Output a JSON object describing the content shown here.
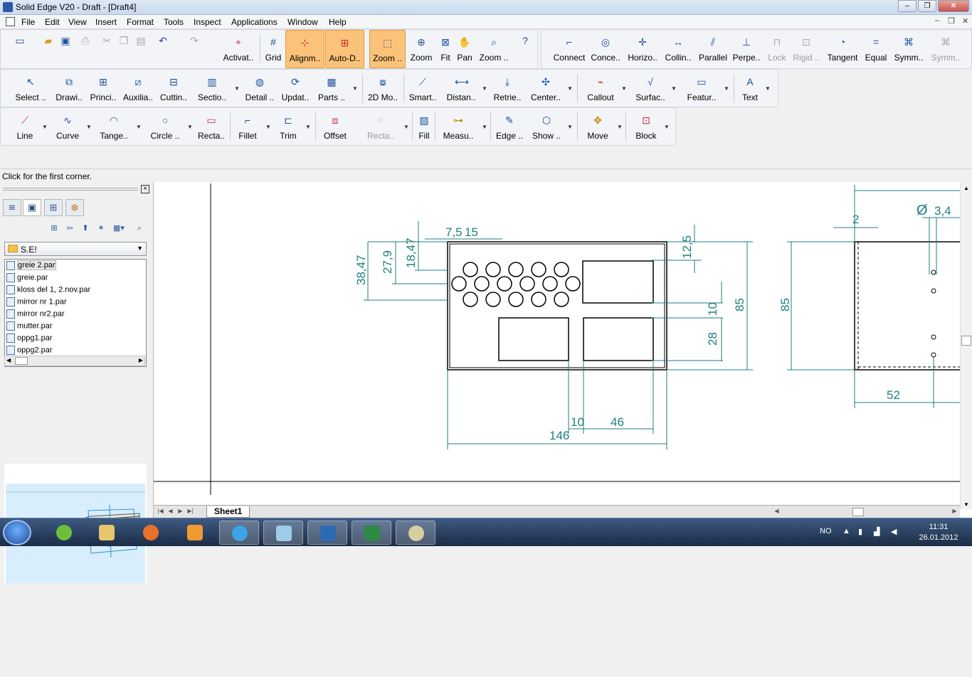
{
  "window": {
    "title": "Solid Edge V20 - Draft - [Draft4]",
    "min": "–",
    "max": "❐",
    "close": "✕"
  },
  "menubar": {
    "items": [
      "File",
      "Edit",
      "View",
      "Insert",
      "Format",
      "Tools",
      "Inspect",
      "Applications",
      "Window",
      "Help"
    ],
    "mdi": [
      "–",
      "❐",
      "✕"
    ]
  },
  "toolbar1": {
    "groupA": [
      {
        "label": "",
        "icon": "new-icon"
      },
      {
        "label": "",
        "icon": "open-icon"
      },
      {
        "label": "",
        "icon": "save-icon"
      },
      {
        "label": "",
        "icon": "print-icon"
      },
      {
        "label": "",
        "icon": "cut-icon"
      },
      {
        "label": "",
        "icon": "copy-icon"
      },
      {
        "label": "",
        "icon": "paste-icon"
      },
      {
        "label": "",
        "icon": "undo-icon"
      },
      {
        "label": "",
        "icon": "redo-icon"
      },
      {
        "label": "Activat..",
        "icon": "activate-icon"
      },
      {
        "label": "Grid",
        "icon": "grid-icon"
      },
      {
        "label": "Alignm..",
        "icon": "alignment-icon",
        "active": true
      },
      {
        "label": "Auto-D..",
        "icon": "auto-dimension-icon",
        "active": true
      },
      {
        "label": "Zoom ..",
        "icon": "zoom-area-icon",
        "active": true
      },
      {
        "label": "Zoom",
        "icon": "zoom-icon"
      },
      {
        "label": "Fit",
        "icon": "fit-icon"
      },
      {
        "label": "Pan",
        "icon": "pan-icon"
      },
      {
        "label": "Zoom ..",
        "icon": "zoom-previous-icon"
      },
      {
        "label": "",
        "icon": "help-icon"
      }
    ],
    "groupB": [
      {
        "label": "Connect",
        "icon": "connect-icon"
      },
      {
        "label": "Conce..",
        "icon": "concentric-icon"
      },
      {
        "label": "Horizo..",
        "icon": "horizontal-icon"
      },
      {
        "label": "Collin..",
        "icon": "collinear-icon"
      },
      {
        "label": "Parallel",
        "icon": "parallel-icon"
      },
      {
        "label": "Perpe..",
        "icon": "perpendicular-icon"
      },
      {
        "label": "Lock",
        "icon": "lock-icon",
        "disabled": true
      },
      {
        "label": "Rigid ..",
        "icon": "rigid-icon",
        "disabled": true
      },
      {
        "label": "Tangent",
        "icon": "tangent-icon"
      },
      {
        "label": "Equal",
        "icon": "equal-icon"
      },
      {
        "label": "Symm..",
        "icon": "symmetric-icon"
      },
      {
        "label": "Symm..",
        "icon": "symmetric-axis-icon",
        "disabled": true
      }
    ]
  },
  "toolbar2": [
    {
      "label": "Select ..",
      "icon": "select-icon"
    },
    {
      "label": "Drawi..",
      "icon": "drawing-view-icon"
    },
    {
      "label": "Princi..",
      "icon": "principal-view-icon"
    },
    {
      "label": "Auxilia..",
      "icon": "auxiliary-view-icon"
    },
    {
      "label": "Cuttin..",
      "icon": "cutting-plane-icon"
    },
    {
      "label": "Sectio..",
      "icon": "section-icon"
    },
    {
      "label": "Detail ..",
      "icon": "detail-icon"
    },
    {
      "label": "Updat..",
      "icon": "update-icon"
    },
    {
      "label": "Parts ..",
      "icon": "parts-list-icon"
    },
    {
      "label": "2D Mo..",
      "icon": "2d-model-icon"
    },
    {
      "label": "Smart..",
      "icon": "smart-dimension-icon"
    },
    {
      "label": "Distan..",
      "icon": "distance-icon"
    },
    {
      "label": "Retrie..",
      "icon": "retrieve-icon"
    },
    {
      "label": "Center..",
      "icon": "center-mark-icon"
    },
    {
      "label": "Callout",
      "icon": "callout-icon"
    },
    {
      "label": "Surfac..",
      "icon": "surface-texture-icon"
    },
    {
      "label": "Featur..",
      "icon": "feature-control-icon"
    },
    {
      "label": "Text",
      "icon": "text-icon"
    }
  ],
  "toolbar3": [
    {
      "label": "Line",
      "icon": "line-icon"
    },
    {
      "label": "Curve",
      "icon": "curve-icon"
    },
    {
      "label": "Tange..",
      "icon": "tangent-arc-icon"
    },
    {
      "label": "Circle ..",
      "icon": "circle-icon"
    },
    {
      "label": "Recta..",
      "icon": "rectangle-icon"
    },
    {
      "label": "Fillet",
      "icon": "fillet-icon"
    },
    {
      "label": "Trim",
      "icon": "trim-icon"
    },
    {
      "label": "Offset",
      "icon": "offset-icon"
    },
    {
      "label": "Recta..",
      "icon": "rectangular-pattern-icon",
      "disabled": true
    },
    {
      "label": "Fill",
      "icon": "fill-icon"
    },
    {
      "label": "Measu..",
      "icon": "measure-icon"
    },
    {
      "label": "Edge ..",
      "icon": "edge-painter-icon"
    },
    {
      "label": "Show ..",
      "icon": "show-icon"
    },
    {
      "label": "Move",
      "icon": "move-icon"
    },
    {
      "label": "Block",
      "icon": "block-icon"
    }
  ],
  "status": {
    "prompt": "Click for the first corner."
  },
  "library": {
    "folder": "S.E!",
    "files": [
      "greie 2.par",
      "greie.par",
      "kloss del 1, 2.nov.par",
      "mirror nr 1.par",
      "mirror nr2.par",
      "mutter.par",
      "oppg1.par",
      "oppg2.par"
    ]
  },
  "drawing": {
    "dims_front": [
      "7,5",
      "15",
      "38,47",
      "27,9",
      "18,47",
      "12,5",
      "10",
      "85",
      "28",
      "10",
      "46",
      "146"
    ],
    "dims_side": [
      "2",
      "Ø",
      "3,4",
      "85",
      "52"
    ],
    "line_color": "#1f7f7f"
  },
  "sheet": {
    "tab": "Sheet1"
  },
  "taskbar": {
    "apps": [
      "spotify-icon",
      "explorer-icon",
      "firefox-icon",
      "media-player-icon",
      "ie-icon",
      "app-icon",
      "solid-edge-icon",
      "excel-icon",
      "paint-icon"
    ],
    "lang": "NO",
    "time": "11:31",
    "date": "26.01.2012"
  }
}
